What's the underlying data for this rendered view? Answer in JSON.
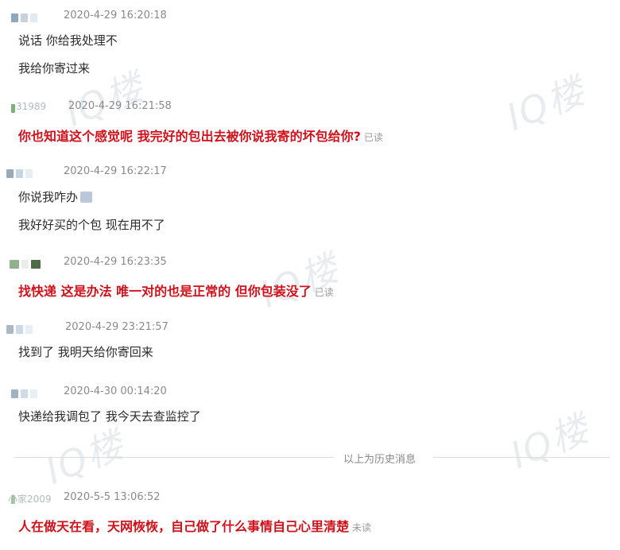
{
  "watermark": "IQ楼",
  "messages": [
    {
      "nick": "",
      "time": "2020-4-29 16:20:18",
      "lines": [
        "说话 你给我处理不",
        "我给你寄过来"
      ],
      "highlight": false,
      "status": "",
      "avatar_colors": [
        "#8ea6bf",
        "#c6d3df",
        "#e3eaf1"
      ]
    },
    {
      "nick": "31989",
      "time": "2020-4-29 16:21:58",
      "lines": [
        "你也知道这个感觉呢  我完好的包出去被你说我寄的坏包给你?"
      ],
      "highlight": true,
      "status": "已读",
      "avatar_colors": [
        "#7fb07a",
        "#e6ede3",
        "#f3f3f3"
      ]
    },
    {
      "nick": "",
      "time": "2020-4-29 16:22:17",
      "lines": [
        "你说我咋办",
        "我好好买的个包 现在用不了"
      ],
      "highlight": false,
      "status": "",
      "emoji_after_line": 0,
      "avatar_colors": [
        "#9aaabb",
        "#c8d5e2",
        "#e6edf4"
      ]
    },
    {
      "nick": "",
      "time": "2020-4-29 16:23:35",
      "lines": [
        "找快递  这是办法  唯一对的也是正常的    但你包装没了"
      ],
      "highlight": true,
      "status": "已读",
      "avatar_colors": [
        "#8fb28c",
        "#e9efe7",
        "#4f6b4c"
      ]
    },
    {
      "nick": "",
      "time": "2020-4-29 23:21:57",
      "lines": [
        "找到了 我明天给你寄回来"
      ],
      "highlight": false,
      "status": "",
      "avatar_colors": [
        "#a9b9c8",
        "#cdd9e4",
        "#e8eef4"
      ]
    },
    {
      "nick": "",
      "time": "2020-4-30 00:14:20",
      "lines": [
        "快递给我调包了 我今天去查监控了"
      ],
      "highlight": false,
      "status": "",
      "avatar_colors": [
        "#9fb1c3",
        "#cfdbe6",
        "#e9eff5"
      ]
    },
    {
      "nick": "小家2009",
      "time": "2020-5-5 13:06:52",
      "lines": [
        "人在做天在看，天网恢恢，自己做了什么事情自己心里清楚"
      ],
      "highlight": true,
      "status": "未读",
      "avatar_colors": [
        "#a7c9a4",
        "#e4eee2",
        "#f4f4f4"
      ]
    }
  ],
  "history_divider": "以上为历史消息"
}
